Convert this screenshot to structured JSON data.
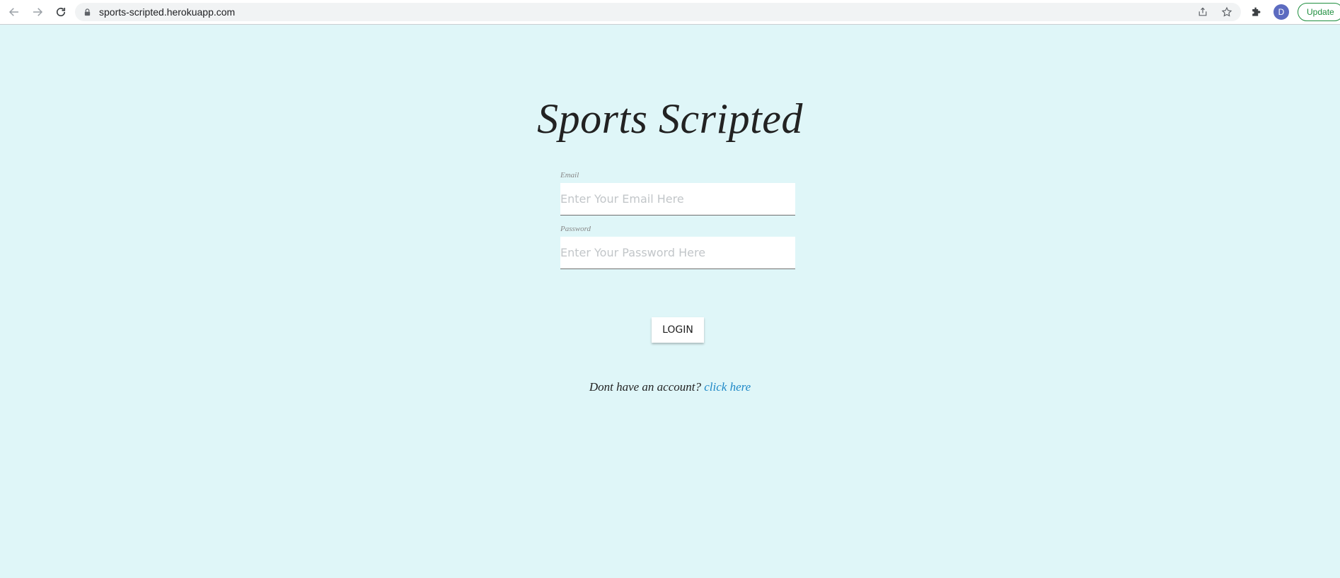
{
  "browser": {
    "url": "sports-scripted.herokuapp.com",
    "avatar_letter": "D",
    "update_label": "Update",
    "icons": [
      "back-arrow-icon",
      "forward-arrow-icon",
      "reload-icon",
      "lock-icon",
      "share-icon",
      "star-icon",
      "extensions-icon"
    ]
  },
  "page": {
    "title": "Sports Scripted",
    "email": {
      "label": "Email",
      "placeholder": "Enter Your Email Here",
      "value": ""
    },
    "password": {
      "label": "Password",
      "placeholder": "Enter Your Password Here",
      "value": ""
    },
    "login_label": "LOGIN",
    "signup_text": "Dont have an account?",
    "signup_link": "click here"
  },
  "colors": {
    "background": "#dff6f8",
    "link": "#1e88c7",
    "update_green": "#1e8e3e",
    "avatar": "#5c6bc0"
  }
}
